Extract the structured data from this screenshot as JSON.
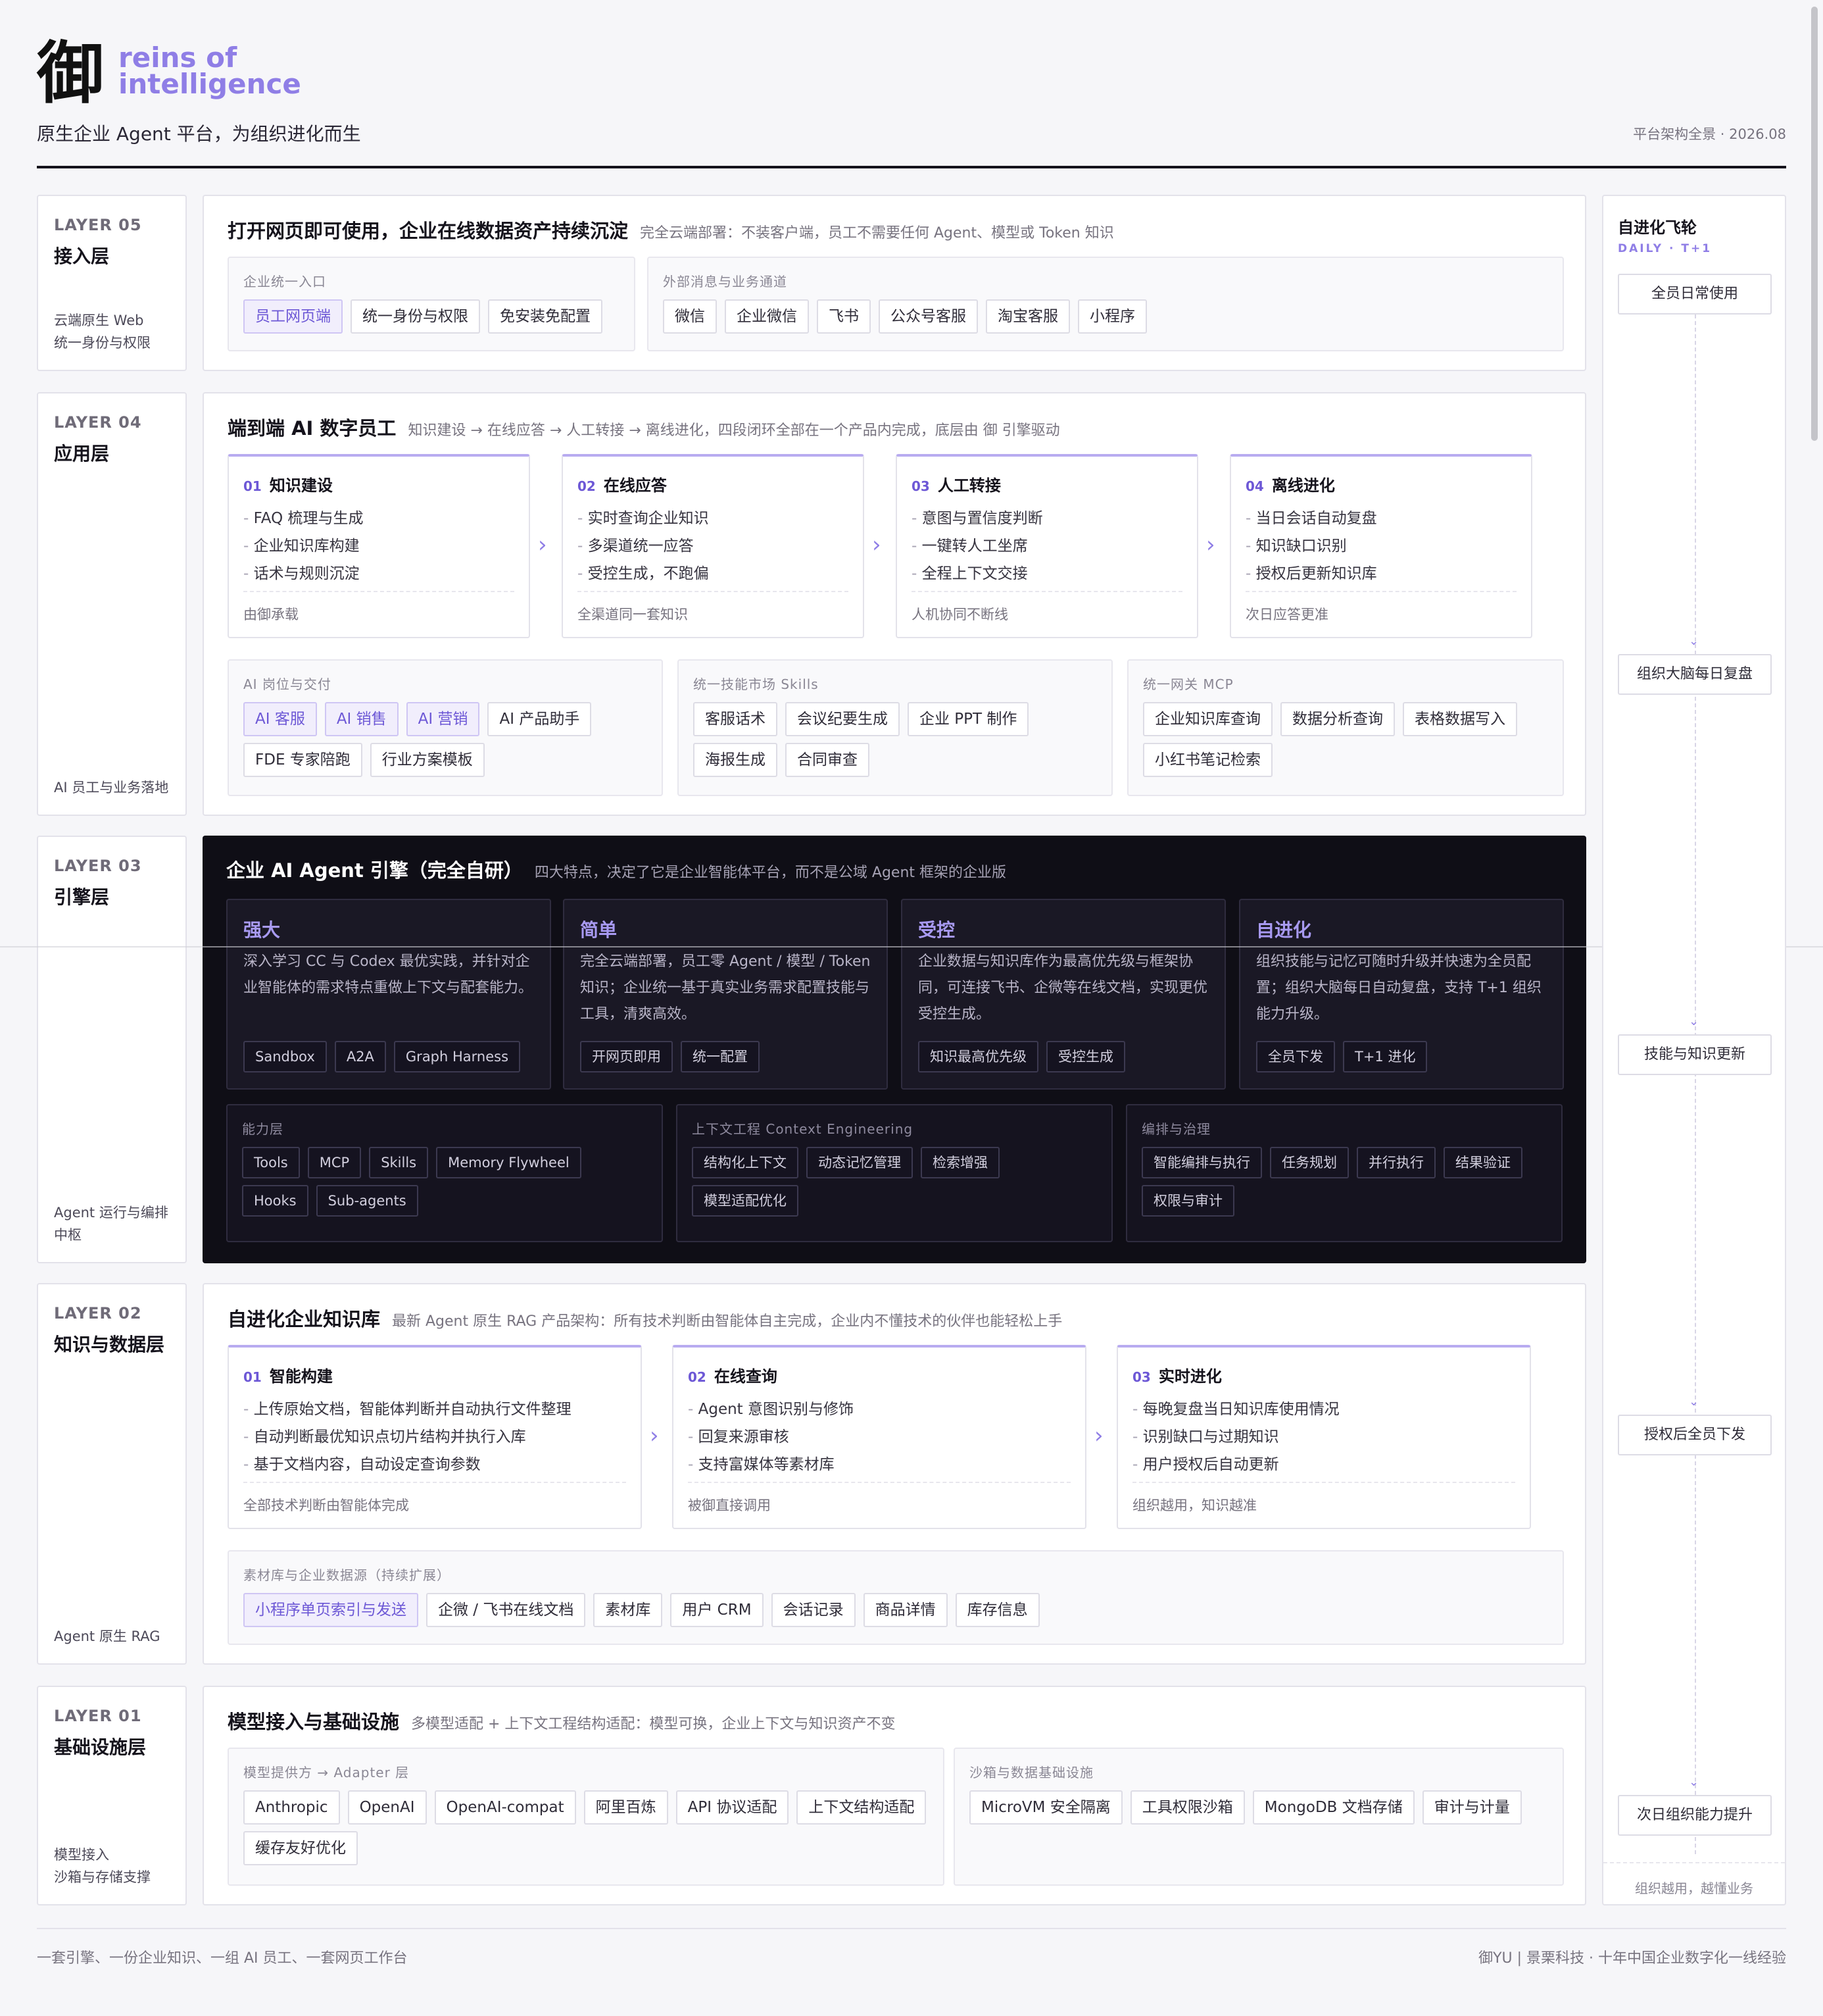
{
  "header": {
    "logo_mark": "御",
    "logo_text": "reins of\nintelligence",
    "tagline": "原生企业 Agent 平台，为组织进化而生",
    "date_note": "平台架构全景 · 2026.08"
  },
  "layers": {
    "l5": {
      "num": "LAYER 05",
      "name": "接入层",
      "desc": "云端原生 Web\n统一身份与权限",
      "title": "打开网页即可使用，企业在线数据资产持续沉淀",
      "subtitle": "完全云端部署：不装客户端，员工不需要任何 Agent、模型或 Token 知识",
      "entry": {
        "label": "企业统一入口",
        "chips": [
          "员工网页端",
          "统一身份与权限",
          "免安装免配置"
        ]
      },
      "channels": {
        "label": "外部消息与业务通道",
        "chips": [
          "微信",
          "企业微信",
          "飞书",
          "公众号客服",
          "淘宝客服",
          "小程序"
        ]
      }
    },
    "l4": {
      "num": "LAYER 04",
      "name": "应用层",
      "desc": "AI 员工与业务落地",
      "title": "端到端 AI 数字员工",
      "subtitle": "知识建设 → 在线应答 → 人工转接 → 离线进化，四段闭环全部在一个产品内完成，底层由 御 引擎驱动",
      "stages": [
        {
          "num": "01",
          "title": "知识建设",
          "items": [
            "FAQ 梳理与生成",
            "企业知识库构建",
            "话术与规则沉淀"
          ],
          "foot": "由御承载"
        },
        {
          "num": "02",
          "title": "在线应答",
          "items": [
            "实时查询企业知识",
            "多渠道统一应答",
            "受控生成，不跑偏"
          ],
          "foot": "全渠道同一套知识"
        },
        {
          "num": "03",
          "title": "人工转接",
          "items": [
            "意图与置信度判断",
            "一键转人工坐席",
            "全程上下文交接"
          ],
          "foot": "人机协同不断线"
        },
        {
          "num": "04",
          "title": "离线进化",
          "items": [
            "当日会话自动复盘",
            "知识缺口识别",
            "授权后更新知识库"
          ],
          "foot": "次日应答更准"
        }
      ],
      "roles": {
        "label": "AI 岗位与交付",
        "chips": [
          "AI 客服",
          "AI 销售",
          "AI 营销",
          "AI 产品助手",
          "FDE 专家陪跑",
          "行业方案模板"
        ]
      },
      "skills": {
        "label": "统一技能市场 Skills",
        "chips": [
          "客服话术",
          "会议纪要生成",
          "企业 PPT 制作",
          "海报生成",
          "合同审查"
        ]
      },
      "mcp": {
        "label": "统一网关 MCP",
        "chips": [
          "企业知识库查询",
          "数据分析查询",
          "表格数据写入",
          "小红书笔记检索"
        ]
      }
    },
    "l3": {
      "num": "LAYER 03",
      "name": "引擎层",
      "desc": "Agent 运行与编排\n中枢",
      "title": "企业 AI Agent 引擎（完全自研）",
      "subtitle": "四大特点，决定了它是企业智能体平台，而不是公域 Agent 框架的企业版",
      "cards": [
        {
          "title": "强大",
          "desc": "深入学习 CC 与 Codex 最优实践，并针对企业智能体的需求特点重做上下文与配套能力。",
          "chips": [
            "Sandbox",
            "A2A",
            "Graph Harness"
          ]
        },
        {
          "title": "简单",
          "desc": "完全云端部署，员工零 Agent / 模型 / Token 知识；企业统一基于真实业务需求配置技能与工具，清爽高效。",
          "chips": [
            "开网页即用",
            "统一配置"
          ]
        },
        {
          "title": "受控",
          "desc": "企业数据与知识库作为最高优先级与框架协同，可连接飞书、企微等在线文档，实现更优受控生成。",
          "chips": [
            "知识最高优先级",
            "受控生成"
          ]
        },
        {
          "title": "自进化",
          "desc": "组织技能与记忆可随时升级并快速为全员配置；组织大脑每日自动复盘，支持 T+1 组织能力升级。",
          "chips": [
            "全员下发",
            "T+1 进化"
          ]
        }
      ],
      "ability": {
        "label": "能力层",
        "chips": [
          "Tools",
          "MCP",
          "Skills",
          "Memory Flywheel",
          "Hooks",
          "Sub-agents"
        ]
      },
      "context": {
        "label": "上下文工程 Context Engineering",
        "chips": [
          "结构化上下文",
          "动态记忆管理",
          "检索增强",
          "模型适配优化"
        ]
      },
      "govern": {
        "label": "编排与治理",
        "chips": [
          "智能编排与执行",
          "任务规划",
          "并行执行",
          "结果验证",
          "权限与审计"
        ]
      }
    },
    "l2": {
      "num": "LAYER 02",
      "name": "知识与数据层",
      "desc": "Agent 原生 RAG",
      "title": "自进化企业知识库",
      "subtitle": "最新 Agent 原生 RAG 产品架构：所有技术判断由智能体自主完成，企业内不懂技术的伙伴也能轻松上手",
      "stages": [
        {
          "num": "01",
          "title": "智能构建",
          "items": [
            "上传原始文档，智能体判断并自动执行文件整理",
            "自动判断最优知识点切片结构并执行入库",
            "基于文档内容，自动设定查询参数"
          ],
          "foot": "全部技术判断由智能体完成"
        },
        {
          "num": "02",
          "title": "在线查询",
          "items": [
            "Agent 意图识别与修饰",
            "回复来源审核",
            "支持富媒体等素材库"
          ],
          "foot": "被御直接调用"
        },
        {
          "num": "03",
          "title": "实时进化",
          "items": [
            "每晚复盘当日知识库使用情况",
            "识别缺口与过期知识",
            "用户授权后自动更新"
          ],
          "foot": "组织越用，知识越准"
        }
      ],
      "sources": {
        "label": "素材库与企业数据源（持续扩展）",
        "chips": [
          "小程序单页索引与发送",
          "企微 / 飞书在线文档",
          "素材库",
          "用户 CRM",
          "会话记录",
          "商品详情",
          "库存信息"
        ]
      }
    },
    "l1": {
      "num": "LAYER 01",
      "name": "基础设施层",
      "desc": "模型接入\n沙箱与存储支撑",
      "title": "模型接入与基础设施",
      "subtitle": "多模型适配 + 上下文工程结构适配：模型可换，企业上下文与知识资产不变",
      "models": {
        "label": "模型提供方 → Adapter 层",
        "chips": [
          "Anthropic",
          "OpenAI",
          "OpenAI-compat",
          "阿里百炼",
          "API 协议适配",
          "上下文结构适配",
          "缓存友好优化"
        ]
      },
      "sandbox": {
        "label": "沙箱与数据基础设施",
        "chips": [
          "MicroVM 安全隔离",
          "工具权限沙箱",
          "MongoDB 文档存储",
          "审计与计量"
        ]
      }
    }
  },
  "side": {
    "title": "自进化飞轮",
    "sub": "DAILY · T+1",
    "steps": [
      "全员日常使用",
      "组织大脑每日复盘",
      "技能与知识更新",
      "授权后全员下发",
      "次日组织能力提升"
    ],
    "foot": "组织越用，越懂业务"
  },
  "footer": {
    "left": "一套引擎、一份企业知识、一组 AI 员工、一套网页工作台",
    "right": "御YU  |  景栗科技 · 十年中国企业数字化一线经验"
  },
  "colors": {
    "accent": "#8f7ee6",
    "dark": "#0f0e16"
  }
}
